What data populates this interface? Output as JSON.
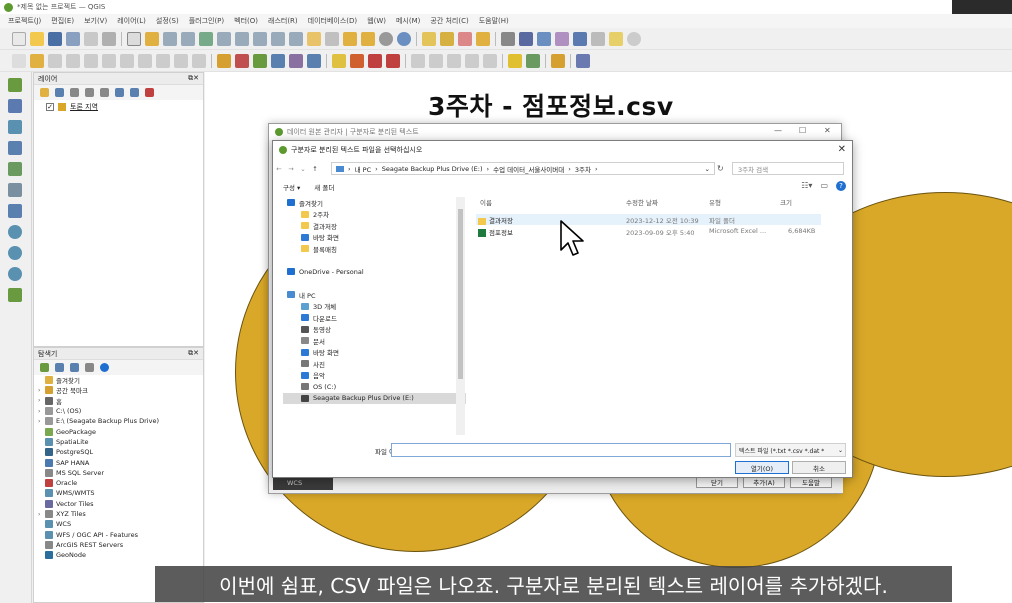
{
  "window": {
    "title": "*제목 없는 프로젝트 — QGIS"
  },
  "menubar": [
    "프로젝트(J)",
    "편집(E)",
    "보기(V)",
    "레이어(L)",
    "설정(S)",
    "플러그인(P)",
    "벡터(O)",
    "래스터(R)",
    "데이터베이스(D)",
    "웹(W)",
    "메시(M)",
    "공간 처리(C)",
    "도움말(H)"
  ],
  "colors": {
    "accent": "#5c9a2f",
    "point_fill": "#d9a828",
    "selection": "#1f6fd1"
  },
  "layers_panel": {
    "title": "레이어",
    "layers": [
      {
        "name": "토론 지역",
        "checked": "✓"
      }
    ]
  },
  "browser_panel": {
    "title": "탐색기",
    "items": [
      {
        "label": "즐겨찾기",
        "arrow": "",
        "icon": "star-icon"
      },
      {
        "label": "공간 북마크",
        "arrow": "›",
        "icon": "bookmark-icon"
      },
      {
        "label": "홈",
        "arrow": "›",
        "icon": "home-icon"
      },
      {
        "label": "C:\\ (OS)",
        "arrow": "›",
        "icon": "drive-icon"
      },
      {
        "label": "E:\\ (Seagate Backup Plus Drive)",
        "arrow": "›",
        "icon": "drive-icon"
      },
      {
        "label": "GeoPackage",
        "arrow": "",
        "icon": "geopackage-icon"
      },
      {
        "label": "SpatiaLite",
        "arrow": "",
        "icon": "spatialite-icon"
      },
      {
        "label": "PostgreSQL",
        "arrow": "",
        "icon": "postgresql-icon"
      },
      {
        "label": "SAP HANA",
        "arrow": "",
        "icon": "sap-hana-icon"
      },
      {
        "label": "MS SQL Server",
        "arrow": "",
        "icon": "mssql-icon"
      },
      {
        "label": "Oracle",
        "arrow": "",
        "icon": "oracle-icon"
      },
      {
        "label": "WMS/WMTS",
        "arrow": "",
        "icon": "wms-icon"
      },
      {
        "label": "Vector Tiles",
        "arrow": "",
        "icon": "vector-tiles-icon"
      },
      {
        "label": "XYZ Tiles",
        "arrow": "›",
        "icon": "xyz-tiles-icon"
      },
      {
        "label": "WCS",
        "arrow": "",
        "icon": "wcs-icon"
      },
      {
        "label": "WFS / OGC API - Features",
        "arrow": "",
        "icon": "wfs-icon"
      },
      {
        "label": "ArcGIS REST Servers",
        "arrow": "",
        "icon": "arcgis-icon"
      },
      {
        "label": "GeoNode",
        "arrow": "",
        "icon": "geonode-icon"
      }
    ]
  },
  "overlay_title": "3주차 - 점포정보.csv",
  "qgis_dialog": {
    "title": "데이터 원본 관리자 | 구분자로 분리된 텍스트",
    "help": "도움말",
    "add": "추가(A)",
    "close": "닫기",
    "bottom_tab": "WCS"
  },
  "file_dialog": {
    "title": "구분자로 분리된 텍스트 파일을 선택하십시오",
    "path": [
      "내 PC",
      "Seagate Backup Plus Drive (E:)",
      "수업 데이터_서울사이버대",
      "3주차"
    ],
    "search_placeholder": "3주차 검색",
    "organize": "구성 ▾",
    "new_folder": "새 폴더",
    "nav": [
      {
        "label": "즐겨찾기",
        "icon": "star-icon",
        "indent": 0,
        "selected": false
      },
      {
        "label": "2주차",
        "icon": "folder-icon",
        "indent": 1,
        "selected": false
      },
      {
        "label": "결과저장",
        "icon": "folder-icon",
        "indent": 1,
        "selected": false
      },
      {
        "label": "바탕 화면",
        "icon": "desktop-icon",
        "indent": 1,
        "selected": false
      },
      {
        "label": "블록매칭",
        "icon": "folder-icon",
        "indent": 1,
        "selected": false
      },
      {
        "label": "",
        "icon": "",
        "indent": 0,
        "selected": false
      },
      {
        "label": "OneDrive - Personal",
        "icon": "onedrive-icon",
        "indent": 0,
        "selected": false
      },
      {
        "label": "",
        "icon": "",
        "indent": 0,
        "selected": false
      },
      {
        "label": "내 PC",
        "icon": "pc-icon",
        "indent": 0,
        "selected": false
      },
      {
        "label": "3D 개체",
        "icon": "3d-objects-icon",
        "indent": 1,
        "selected": false
      },
      {
        "label": "다운로드",
        "icon": "download-icon",
        "indent": 1,
        "selected": false
      },
      {
        "label": "동영상",
        "icon": "video-icon",
        "indent": 1,
        "selected": false
      },
      {
        "label": "문서",
        "icon": "document-icon",
        "indent": 1,
        "selected": false
      },
      {
        "label": "바탕 화면",
        "icon": "desktop-icon",
        "indent": 1,
        "selected": false
      },
      {
        "label": "사진",
        "icon": "pictures-icon",
        "indent": 1,
        "selected": false
      },
      {
        "label": "음악",
        "icon": "music-icon",
        "indent": 1,
        "selected": false
      },
      {
        "label": "OS (C:)",
        "icon": "drive-icon",
        "indent": 1,
        "selected": false
      },
      {
        "label": "Seagate Backup Plus Drive (E:)",
        "icon": "usb-drive-icon",
        "indent": 1,
        "selected": true
      }
    ],
    "columns": [
      "이름",
      "수정한 날짜",
      "유형",
      "크기"
    ],
    "files": [
      {
        "name": "결과저장",
        "date": "2023-12-12 오전 10:39",
        "type": "파일 폴더",
        "size": "",
        "kind": "folder"
      },
      {
        "name": "점포정보",
        "date": "2023-09-09 오후 5:40",
        "type": "Microsoft Excel ...",
        "size": "6,684KB",
        "kind": "excel"
      }
    ],
    "filename_label": "파일 이름(N):",
    "filename_value": "",
    "filetype": "텍스트 파일 (*.txt *.csv *.dat *",
    "open": "열기(O)",
    "cancel": "취소"
  },
  "subtitle": "이번에 쉼표, CSV 파일은 나오죠. 구분자로 분리된 텍스트 레이어를 추가하겠다."
}
